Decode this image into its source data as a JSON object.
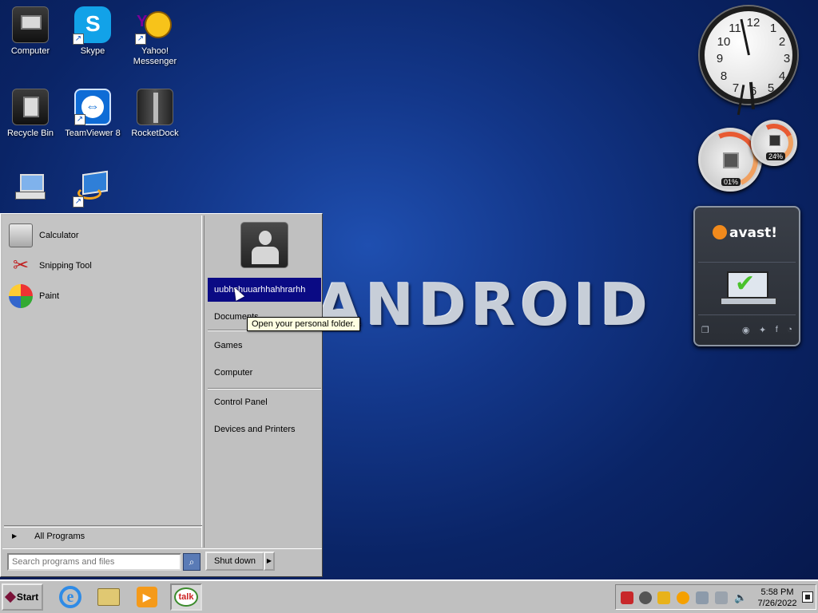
{
  "wallpaper": {
    "text": "ANDROID"
  },
  "desktop_icons": [
    {
      "label": "Computer"
    },
    {
      "label": "Skype"
    },
    {
      "label": "Yahoo! Messenger"
    },
    {
      "label": "Recycle Bin"
    },
    {
      "label": "TeamViewer 8"
    },
    {
      "label": "RocketDock"
    }
  ],
  "gadgets": {
    "clock": {
      "numbers": [
        "12",
        "1",
        "2",
        "3",
        "4",
        "5",
        "6",
        "7",
        "8",
        "9",
        "10",
        "11"
      ]
    },
    "cpu_meter": {
      "cpu": "01%",
      "ram": "24%"
    },
    "avast": {
      "logo": "avast!"
    }
  },
  "start_menu": {
    "programs": [
      {
        "label": "Calculator"
      },
      {
        "label": "Snipping Tool"
      },
      {
        "label": "Paint"
      }
    ],
    "all_programs": "All Programs",
    "search_placeholder": "Search programs and files",
    "shutdown": "Shut down",
    "user_name": "uubhshuuarhhahhrarhh",
    "right_items": {
      "documents": "Documents",
      "games": "Games",
      "computer": "Computer",
      "control_panel": "Control Panel",
      "devices": "Devices and Printers"
    },
    "tooltip": "Open your personal folder."
  },
  "taskbar": {
    "start_label": "Start",
    "time": "5:58 PM",
    "date": "7/26/2022",
    "talk_label": "talk"
  },
  "colors": {
    "selection": "#0a0a84",
    "taskbar": "#c0c0c0",
    "wallpaper": "#0a2466"
  }
}
